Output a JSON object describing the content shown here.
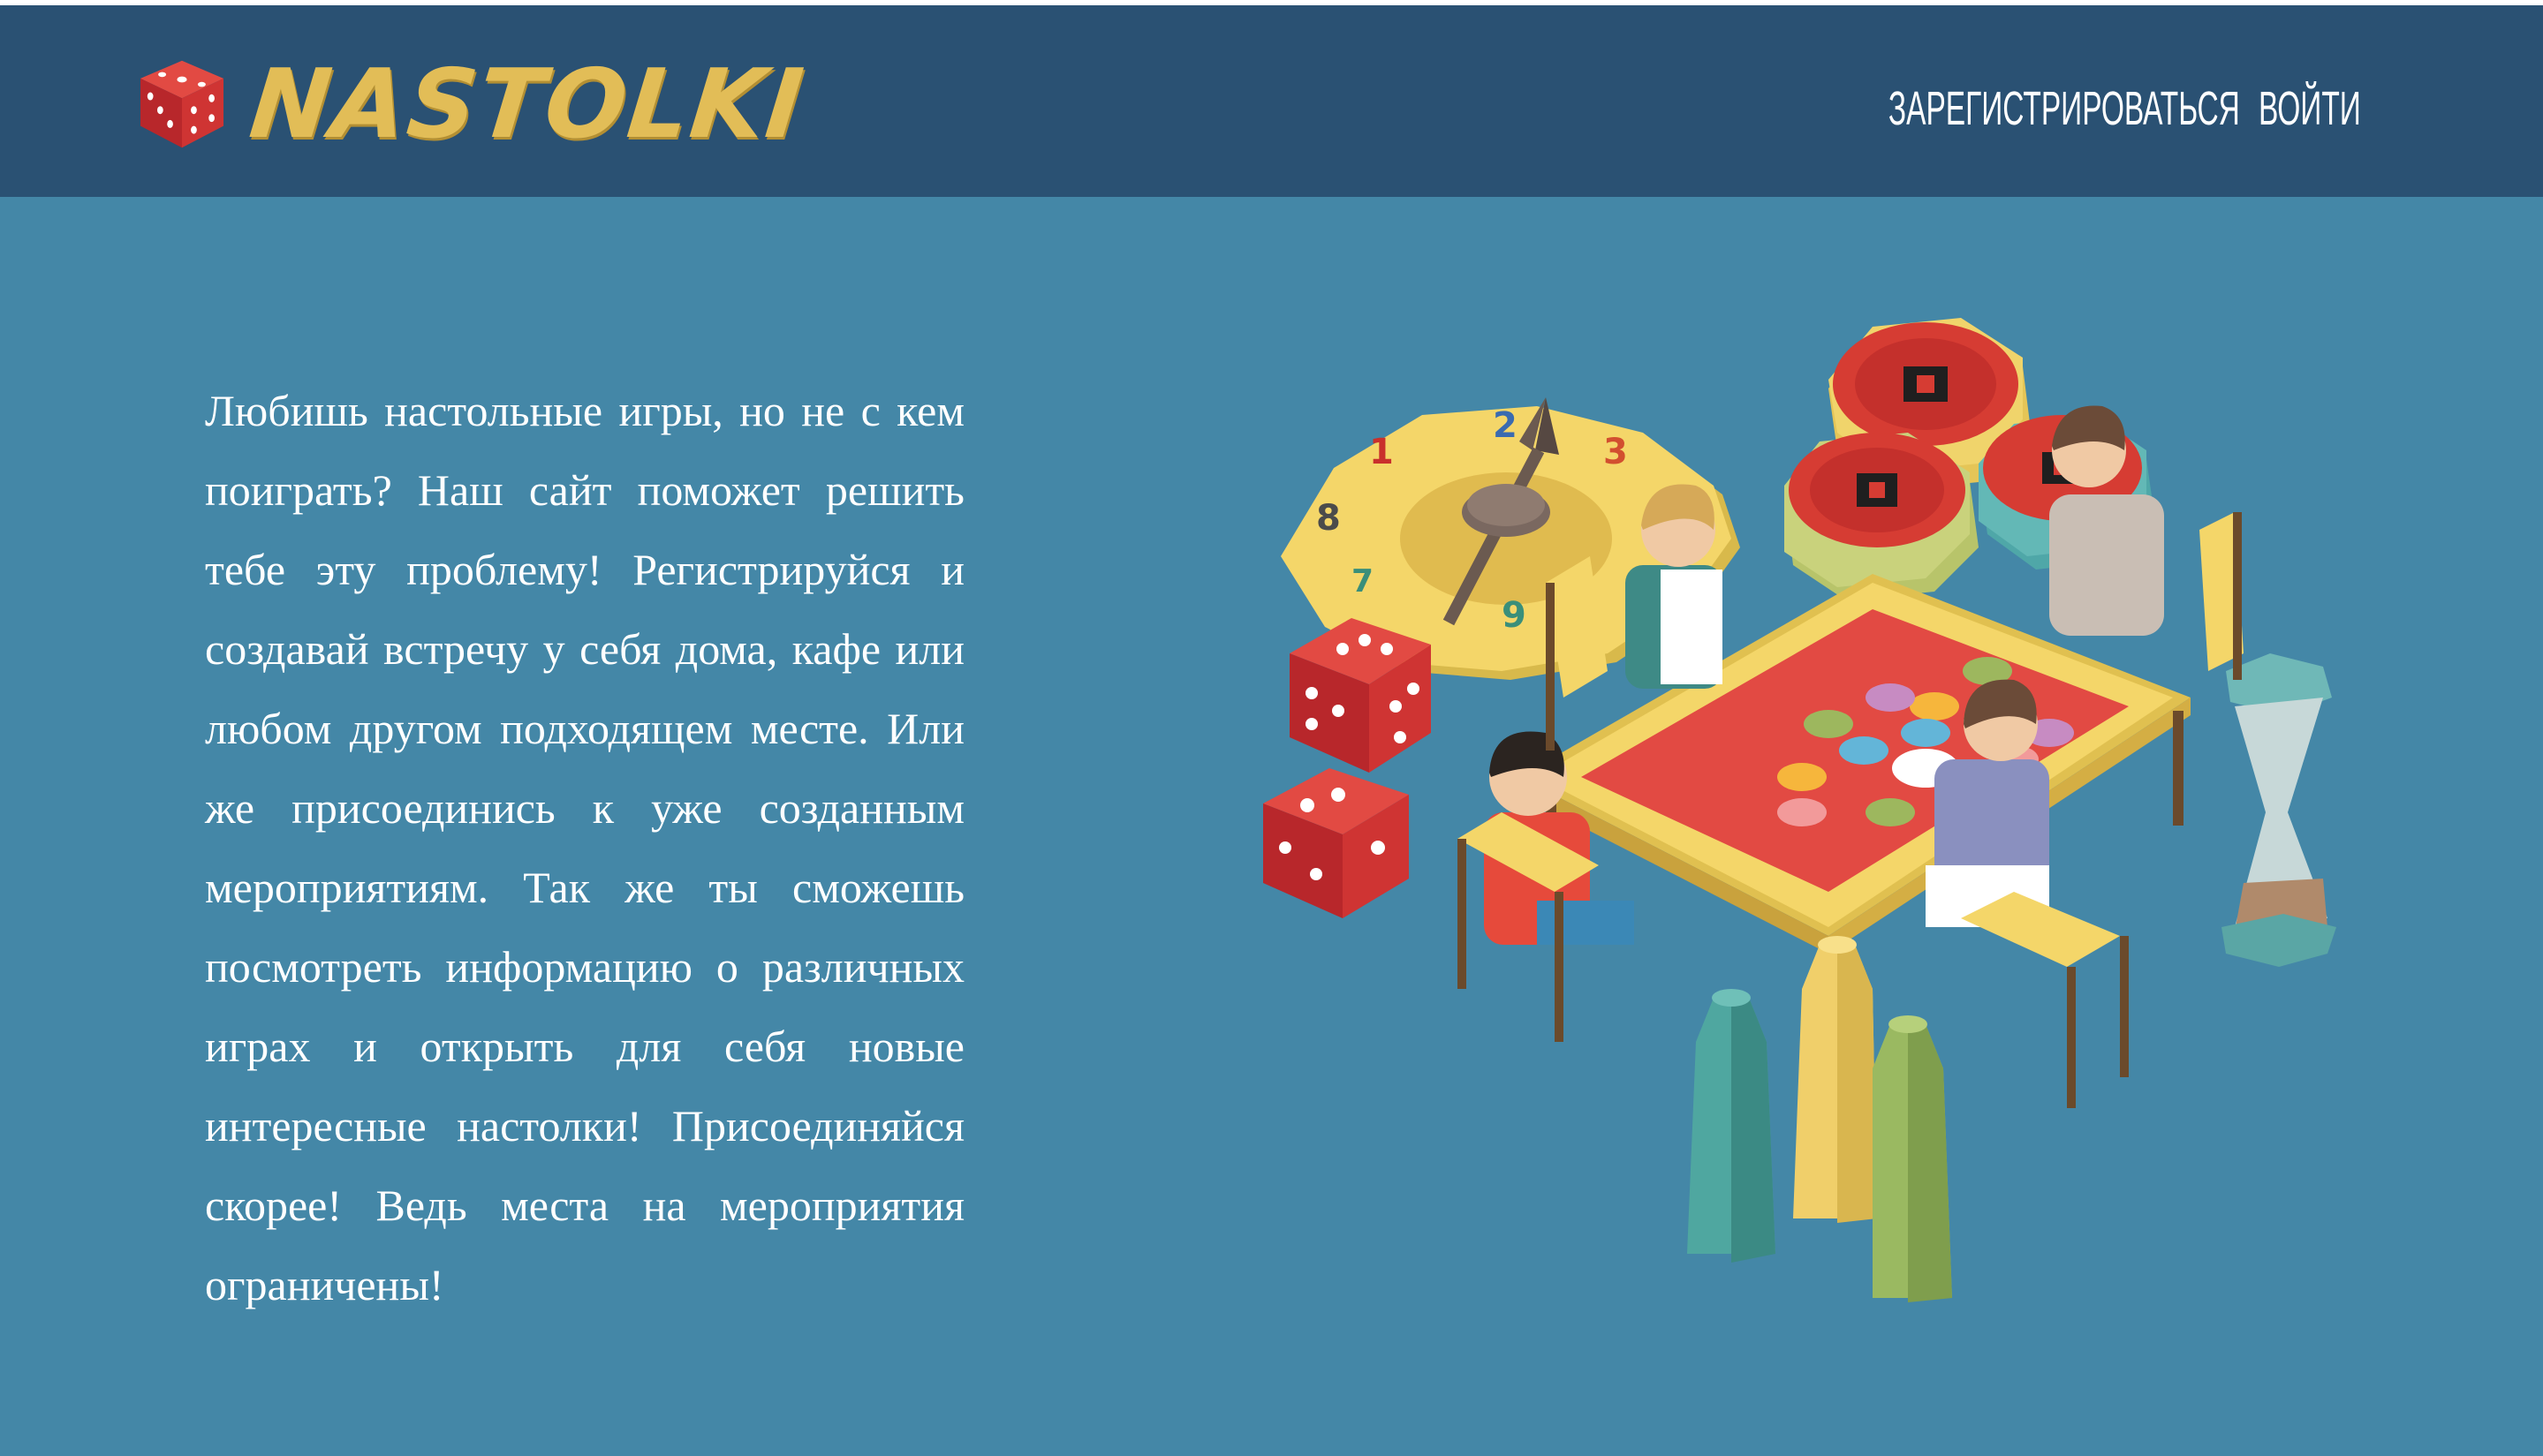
{
  "header": {
    "logo_text": "NASTOLKI",
    "nav": {
      "register_label": "ЗАРЕГИСТРИРОВАТЬСЯ",
      "login_label": "ВОЙТИ"
    }
  },
  "main": {
    "intro_text": "Любишь настольные игры, но не с кем поиграть? Наш сайт поможет решить тебе эту проблему! Регистрируйся и создавай встречу у себя дома, кафе или любом другом подходящем месте. Или же присоединись к уже созданным мероприятиям. Так же ты сможешь посмотреть информацию о различных играх и открыть для себя новые интересные настолки! Присоединяйся скорее! Ведь места на мероприятия ограничены!",
    "spinner_numbers": [
      "1",
      "2",
      "3",
      "8",
      "9",
      "7"
    ]
  },
  "colors": {
    "page_background": "#4487a7",
    "header_background": "#2a5173",
    "logo_gold": "#e2bd57",
    "nav_text": "#ffffff",
    "dice_red": "#c62f2f",
    "board_yellow": "#f4d669"
  },
  "icons": {
    "logo_icon": "dice-icon"
  }
}
